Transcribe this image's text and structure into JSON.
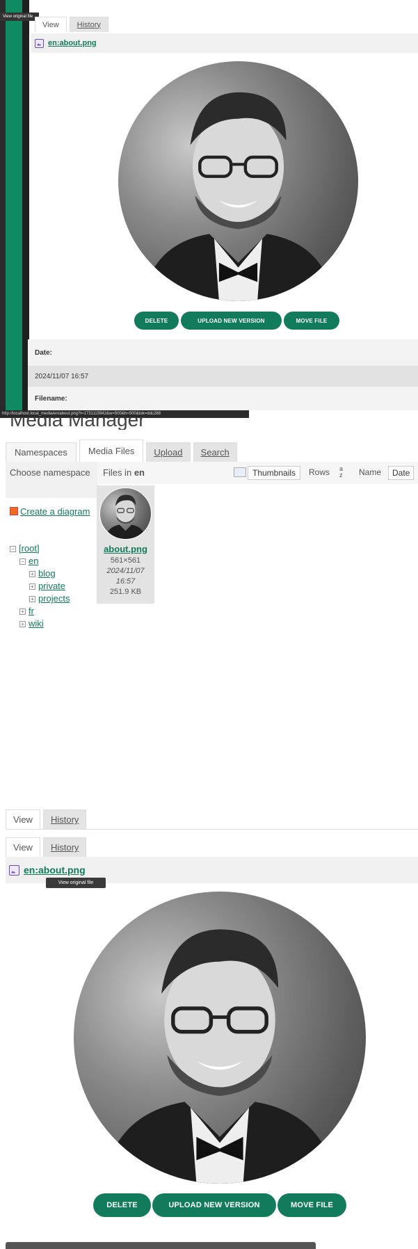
{
  "top_preview": {
    "tooltip": "View original file",
    "tabs": [
      "View",
      "History"
    ],
    "file_link": "en:about.png",
    "buttons": [
      "DELETE",
      "UPLOAD NEW VERSION",
      "MOVE FILE"
    ],
    "meta": [
      {
        "label": "Date:",
        "value": "2024/11/07 16:57"
      },
      {
        "label": "Filename:",
        "value": ""
      }
    ],
    "status_url": "http://localhost.local_media/en/about.png?t=1731115942&w=500&h=500&tok=ddc288"
  },
  "media_manager": {
    "title": "Media Manager",
    "tabs": [
      "Namespaces",
      "Media Files",
      "Upload",
      "Search"
    ],
    "choose_namespace": "Choose namespace",
    "create_diagram": "Create a diagram",
    "tree": [
      {
        "label": "[root]",
        "level": 0
      },
      {
        "label": "en",
        "level": 1
      },
      {
        "label": "blog",
        "level": 2
      },
      {
        "label": "private",
        "level": 2
      },
      {
        "label": "projects",
        "level": 2
      },
      {
        "label": "fr",
        "level": 1
      },
      {
        "label": "wiki",
        "level": 1
      }
    ],
    "files_in_label": "Files in",
    "files_in_ns": "en",
    "view_options": [
      "Thumbnails",
      "Rows"
    ],
    "sort_options": [
      "Name",
      "Date"
    ],
    "file": {
      "name": "about.png",
      "dimensions": "561×561",
      "date": "2024/11/07",
      "time": "16:57",
      "size": "251.9 KB"
    }
  },
  "bottom_preview": {
    "tabs": [
      "View",
      "History"
    ],
    "tabs2": [
      "View",
      "History"
    ],
    "file_link": "en:about.png",
    "tooltip": "View original file",
    "buttons": [
      "DELETE",
      "UPLOAD NEW VERSION",
      "MOVE FILE"
    ]
  },
  "colors": {
    "accent": "#117b5c",
    "sidebar": "#0f8a63"
  }
}
